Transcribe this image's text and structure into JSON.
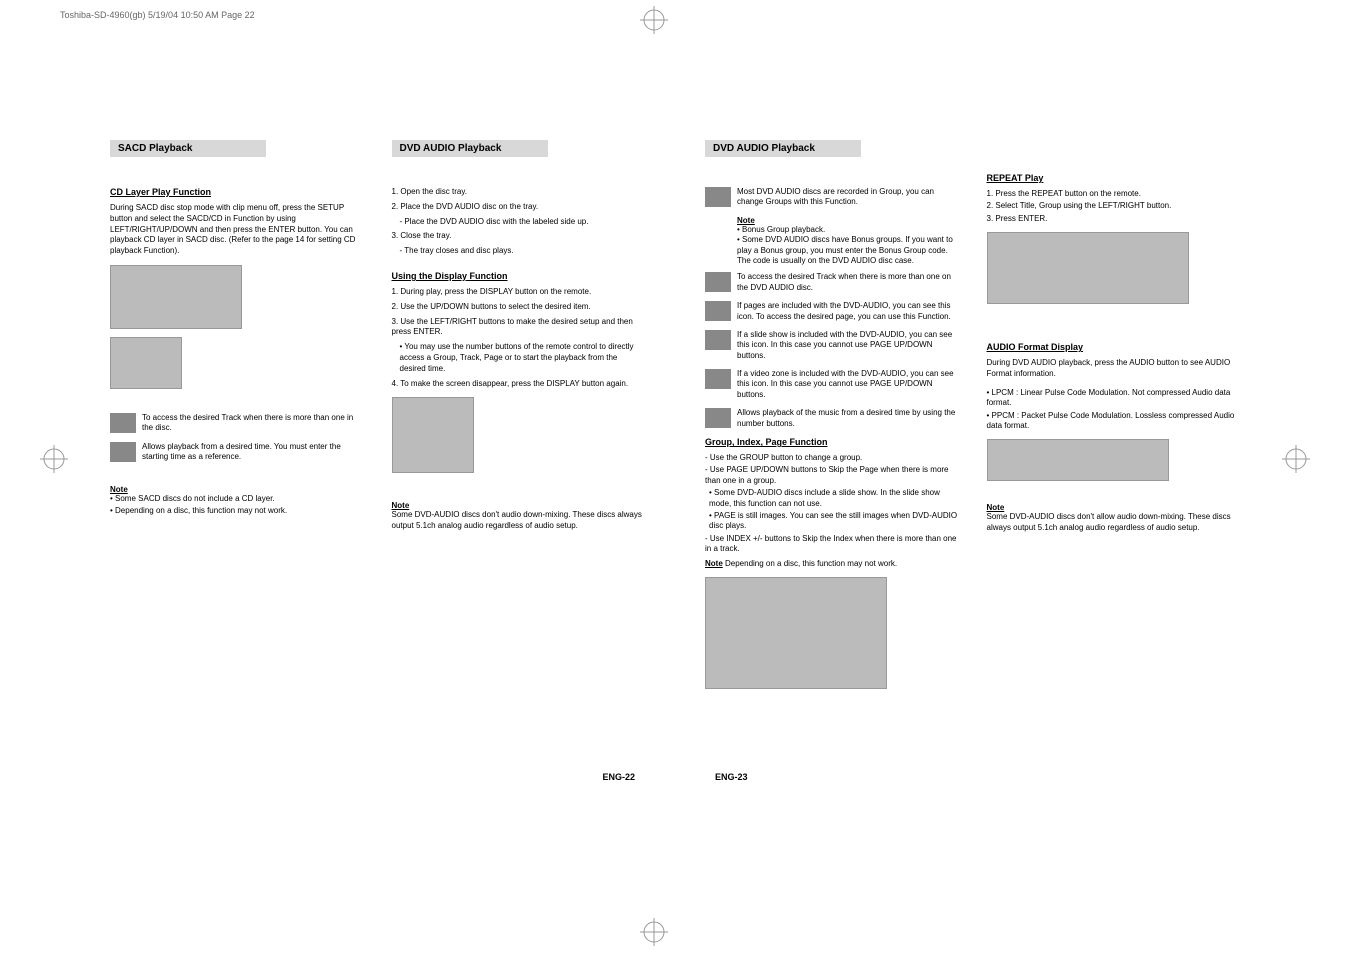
{
  "print_header": "Toshiba-SD-4960(gb)  5/19/04 10:50 AM  Page 22",
  "left_page": {
    "section1": "SACD Playback",
    "sub1": "CD Layer Play Function",
    "para1": "During SACD disc stop mode with clip menu off, press the SETUP button and select the SACD/CD in Function by using LEFT/RIGHT/UP/DOWN and then press the ENTER button. You can playback CD layer in SACD disc. (Refer to the page 14 for setting CD playback Function).",
    "icon_track": "To access the desired Track when there is more than one in the disc.",
    "icon_time": "Allows playback from a desired time. You must enter the starting time as a reference.",
    "note_label": "Note",
    "note_lines": [
      "• Some SACD discs do not include a CD layer.",
      "• Depending on a disc, this function may not work."
    ],
    "section2": "DVD AUDIO Playback",
    "steps": [
      "1. Open the disc tray.",
      "2. Place the DVD AUDIO disc on the tray.",
      "   - Place the DVD AUDIO disc with the labeled side up.",
      "3. Close the tray.",
      "   - The tray closes and disc plays."
    ],
    "sub2": "Using the Display Function",
    "display_steps": [
      "1. During play, press the DISPLAY button on the remote.",
      "2. Use the UP/DOWN buttons to select the desired item.",
      "3. Use the LEFT/RIGHT buttons to make the desired setup and then press ENTER.",
      "   • You may use the number buttons of the remote control to directly access a Group, Track, Page or to start the playback from the desired time.",
      "4. To make the screen disappear, press the DISPLAY button again."
    ],
    "note2": "Some DVD-AUDIO discs don't audio down-mixing. These discs always output 5.1ch analog audio regardless of audio setup.",
    "page_num": "ENG-22"
  },
  "right_page": {
    "section1": "DVD AUDIO Playback",
    "icon_group": "Most DVD AUDIO discs are recorded in Group, you can change Groups with this Function.",
    "note1_label": "Note",
    "note1": "• Bonus Group playback.\n• Some DVD AUDIO discs have Bonus groups. If you want to play a Bonus group, you must enter the Bonus Group code. The code is usually on the DVD AUDIO disc case.",
    "icon_track": "To access the desired Track when there is more than one on the DVD AUDIO disc.",
    "icon_page": "If pages are included with the DVD-AUDIO, you can see this icon. To access the desired page, you can use this Function.",
    "icon_slide": "If a slide show is included with the DVD-AUDIO, you can see this icon. In this case you cannot use PAGE UP/DOWN buttons.",
    "icon_vzone": "If a video zone is included with the DVD-AUDIO, you can see this icon. In this case you cannot use PAGE UP/DOWN buttons.",
    "icon_time": "Allows playback of the music from a desired time by using the number buttons.",
    "sub2": "Group, Index, Page Function",
    "group_lines": [
      "- Use the GROUP button to change a group.",
      "- Use PAGE UP/DOWN buttons to Skip the Page when there is more than one in a group.",
      "• Some DVD-AUDIO discs include a slide show. In the slide show mode, this function can not use.",
      "• PAGE is still images. You can see the still images when DVD-AUDIO disc plays.",
      "- Use INDEX +/- buttons to Skip the Index when there is more than one in a track."
    ],
    "note_depending_label": "Note",
    "note_depending": "  Depending on a disc, this function may not work.",
    "sub3": "REPEAT Play",
    "repeat_steps": [
      "1. Press the REPEAT button on the remote.",
      "2. Select Title, Group using the LEFT/RIGHT button.",
      "3. Press ENTER."
    ],
    "sub4": "AUDIO Format Display",
    "audio_para": "During DVD AUDIO playback, press the AUDIO button to see AUDIO Format information.",
    "audio_lines": [
      "• LPCM : Linear Pulse Code Modulation. Not compressed Audio data format.",
      "• PPCM : Packet Pulse Code Modulation. Lossless compressed Audio data format."
    ],
    "note3": "Some DVD-AUDIO discs don't allow audio down-mixing. These discs always output 5.1ch analog audio regardless of audio setup.",
    "page_num": "ENG-23"
  }
}
